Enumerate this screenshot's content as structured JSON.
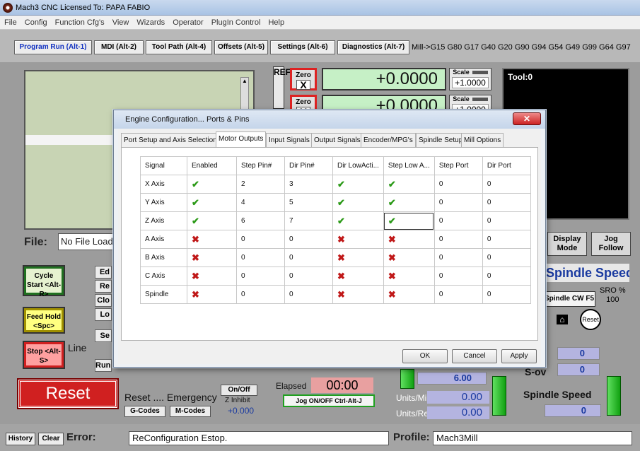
{
  "window": {
    "title": "Mach3 CNC  Licensed To: PAPA FABIO"
  },
  "menu": [
    "File",
    "Config",
    "Function Cfg's",
    "View",
    "Wizards",
    "Operator",
    "PlugIn Control",
    "Help"
  ],
  "top_tabs": [
    {
      "label": "Program Run (Alt-1)",
      "active": true
    },
    {
      "label": "MDI (Alt-2)"
    },
    {
      "label": "Tool Path (Alt-4)"
    },
    {
      "label": "Offsets (Alt-5)"
    },
    {
      "label": "Settings (Alt-6)"
    },
    {
      "label": "Diagnostics (Alt-7)"
    }
  ],
  "gcode_line": "Mill->G15  G80 G17 G40 G20 G90 G94 G54 G49 G99 G64 G97",
  "ref_label": "REF",
  "dro": [
    {
      "zero_label": "Zero",
      "axis": "X",
      "value": "+0.0000",
      "scale_label": "Scale",
      "scale": "+1.0000"
    },
    {
      "zero_label": "Zero",
      "axis": "Y",
      "value": "+0.0000",
      "scale_label": "Scale",
      "scale": "+1.0000"
    }
  ],
  "tool_label": "Tool:0",
  "file": {
    "label": "File:",
    "value": "No File Loaded"
  },
  "display_mode": "Display Mode",
  "jog_follow": "Jog Follow",
  "spindle_title": "Spindle Speed",
  "spindle_cw": "Spindle CW F5",
  "sro": {
    "label": "SRO %",
    "value": "100"
  },
  "reset_small": "Reset",
  "right_values": [
    "0",
    "0"
  ],
  "s_ov_label": "S-ov",
  "buttons": {
    "cycle_start": "Cycle Start <Alt-R>",
    "feed_hold": "Feed Hold <Spc>",
    "stop": "Stop <Alt-S>",
    "side": [
      "Ed",
      "Re",
      "Clo",
      "Lo",
      "Se",
      "Run"
    ]
  },
  "line_label": "Line",
  "reset_big": "Reset",
  "reset_emergency": "Reset .... Emergency",
  "onoff": "On/Off",
  "z_inhibit": "Z Inhibit",
  "z_value": "+0.000",
  "gcodes_btn": "G-Codes",
  "mcodes_btn": "M-Codes",
  "elapsed": {
    "label": "Elapsed",
    "value": "00:00"
  },
  "jog_btn": "Jog ON/OFF Ctrl-Alt-J",
  "feed_value": "6.00",
  "units_min": {
    "label": "Units/Min",
    "value": "0.00"
  },
  "units_rev": {
    "label": "Units/Rev",
    "value": "0.00"
  },
  "spindle_speed": {
    "label": "Spindle Speed",
    "value": "0"
  },
  "statusbar": {
    "history": "History",
    "clear": "Clear",
    "error_label": "Error:",
    "error_text": "ReConfiguration Estop.",
    "profile_label": "Profile:",
    "profile": "Mach3Mill"
  },
  "dialog": {
    "title": "Engine Configuration... Ports & Pins",
    "close": "✕",
    "tabs": [
      {
        "label": "Port Setup and Axis Selection"
      },
      {
        "label": "Motor Outputs",
        "active": true
      },
      {
        "label": "Input Signals"
      },
      {
        "label": "Output Signals"
      },
      {
        "label": "Encoder/MPG's"
      },
      {
        "label": "Spindle Setup"
      },
      {
        "label": "Mill Options"
      }
    ],
    "columns": [
      "Signal",
      "Enabled",
      "Step Pin#",
      "Dir Pin#",
      "Dir LowActi...",
      "Step Low A...",
      "Step Port",
      "Dir Port"
    ],
    "rows": [
      {
        "signal": "X Axis",
        "enabled": true,
        "step_pin": "2",
        "dir_pin": "3",
        "dir_low": true,
        "step_low": true,
        "step_port": "0",
        "dir_port": "0"
      },
      {
        "signal": "Y Axis",
        "enabled": true,
        "step_pin": "4",
        "dir_pin": "5",
        "dir_low": true,
        "step_low": true,
        "step_port": "0",
        "dir_port": "0"
      },
      {
        "signal": "Z Axis",
        "enabled": true,
        "step_pin": "6",
        "dir_pin": "7",
        "dir_low": true,
        "step_low": true,
        "step_port": "0",
        "dir_port": "0"
      },
      {
        "signal": "A Axis",
        "enabled": false,
        "step_pin": "0",
        "dir_pin": "0",
        "dir_low": false,
        "step_low": false,
        "step_port": "0",
        "dir_port": "0"
      },
      {
        "signal": "B Axis",
        "enabled": false,
        "step_pin": "0",
        "dir_pin": "0",
        "dir_low": false,
        "step_low": false,
        "step_port": "0",
        "dir_port": "0"
      },
      {
        "signal": "C Axis",
        "enabled": false,
        "step_pin": "0",
        "dir_pin": "0",
        "dir_low": false,
        "step_low": false,
        "step_port": "0",
        "dir_port": "0"
      },
      {
        "signal": "Spindle",
        "enabled": false,
        "step_pin": "0",
        "dir_pin": "0",
        "dir_low": false,
        "step_low": false,
        "step_port": "0",
        "dir_port": "0"
      }
    ],
    "ok": "OK",
    "cancel": "Cancel",
    "apply": "Apply"
  }
}
